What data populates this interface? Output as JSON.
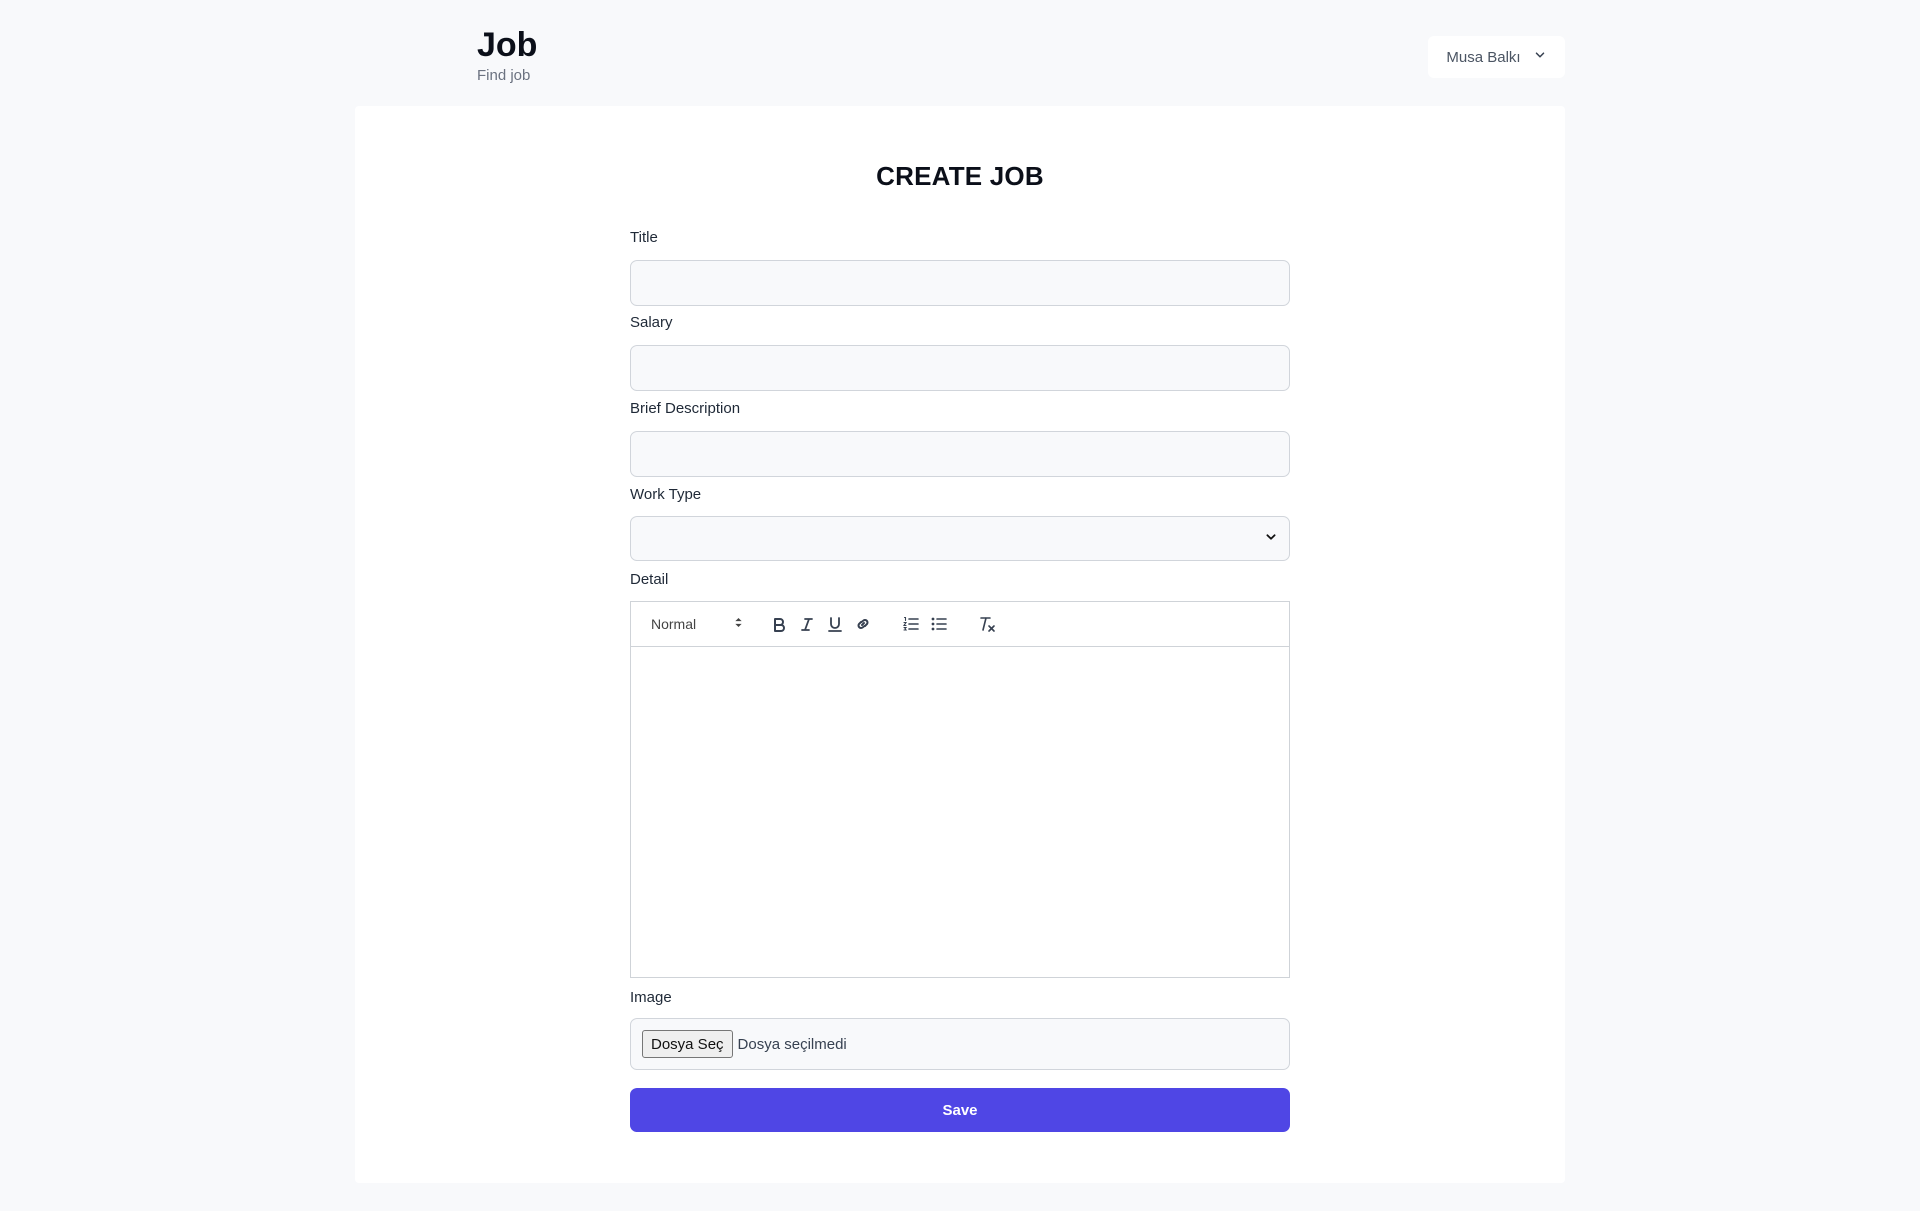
{
  "brand": {
    "title": "Job",
    "subtitle": "Find job"
  },
  "user_menu": {
    "name": "Musa Balkı",
    "icon": "chevron-down-icon"
  },
  "page": {
    "title": "CREATE JOB"
  },
  "form": {
    "title_label": "Title",
    "title_value": "",
    "salary_label": "Salary",
    "salary_value": "",
    "brief_label": "Brief Description",
    "brief_value": "",
    "work_type_label": "Work Type",
    "work_type_value": "",
    "detail_label": "Detail",
    "editor": {
      "heading_select": "Normal",
      "tools": [
        "bold-icon",
        "italic-icon",
        "underline-icon",
        "link-icon",
        "ordered-list-icon",
        "bullet-list-icon",
        "clear-format-icon"
      ]
    },
    "image_label": "Image",
    "file_button": "Dosya Seç",
    "file_status": "Dosya seçilmedi",
    "save_label": "Save"
  },
  "colors": {
    "accent": "#4f46e5",
    "background": "#f8f9fb",
    "card": "#ffffff"
  }
}
